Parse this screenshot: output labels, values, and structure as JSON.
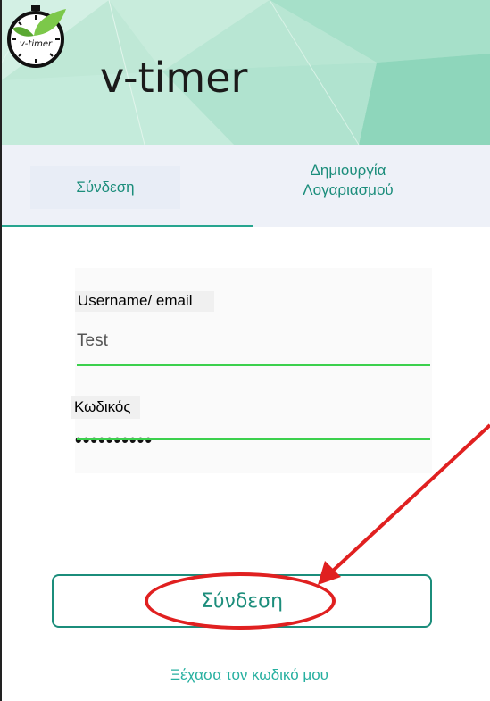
{
  "app": {
    "brand_name": "v-timer",
    "logo_text": "v-timer"
  },
  "tabs": {
    "login_label": "Σύνδεση",
    "create_account_line1": "Δημιουργία",
    "create_account_line2": "Λογαριασμού"
  },
  "form": {
    "username_label": "Username/ email",
    "username_value": "Test",
    "password_label": "Κωδικός",
    "password_value": "••••••••••"
  },
  "actions": {
    "login_button_label": "Σύνδεση",
    "forgot_password_link": "Ξέχασα τον κωδικό μου"
  },
  "colors": {
    "accent": "#1b8d7b",
    "input_underline": "#3cd04d",
    "annotation": "#e02020",
    "header_bg": "#bfe8d6"
  },
  "icons": [
    "stopwatch-leaf-logo-icon"
  ]
}
